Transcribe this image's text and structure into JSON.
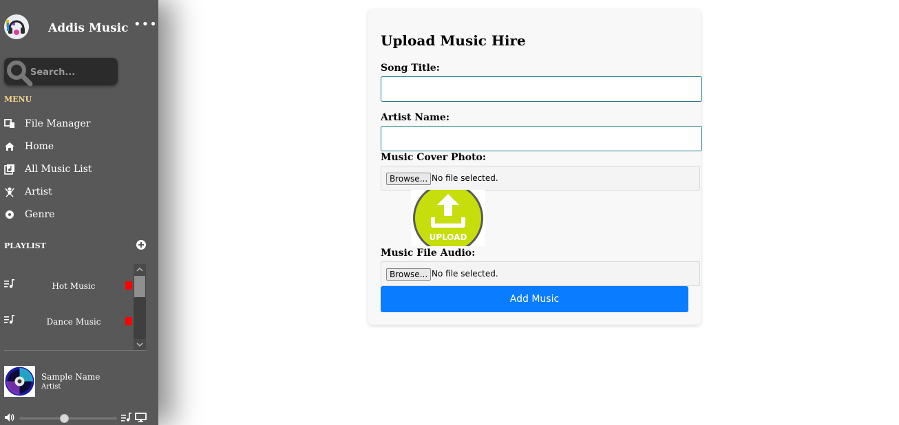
{
  "app": {
    "name": "Addis Music",
    "more_icon": "more-dots-icon"
  },
  "search": {
    "placeholder": "Search...",
    "icon": "search-icon"
  },
  "menu": {
    "heading": "MENU",
    "items": [
      {
        "label": "File Manager",
        "icon": "file-manager-icon"
      },
      {
        "label": "Home",
        "icon": "home-icon"
      },
      {
        "label": "All Music List",
        "icon": "music-list-icon"
      },
      {
        "label": "Artist",
        "icon": "artist-icon"
      },
      {
        "label": "Genre",
        "icon": "genre-disc-icon"
      }
    ]
  },
  "playlist": {
    "heading": "PLAYLIST",
    "add_icon": "add-circle-icon",
    "items": [
      {
        "label": "Hot Music",
        "icon": "playlist-icon",
        "delete_color": "#ff0000"
      },
      {
        "label": "Dance Music",
        "icon": "playlist-icon",
        "delete_color": "#ff0000"
      }
    ]
  },
  "now_playing": {
    "title": "Sample Name",
    "artist": "Artist",
    "art_icon": "cd-disc-icon",
    "volume_fraction": 0.46
  },
  "form": {
    "title": "Upload Music Hire",
    "song_title_label": "Song Title:",
    "song_title_value": "",
    "artist_name_label": "Artist Name:",
    "artist_name_value": "",
    "cover_label": "Music Cover Photo:",
    "cover_browse": "Browse...",
    "cover_status": "No file selected.",
    "upload_image_text": "UPLOAD",
    "audio_label": "Music File Audio:",
    "audio_browse": "Browse...",
    "audio_status": "No file selected.",
    "submit_label": "Add Music"
  },
  "colors": {
    "sidebar_bg": "#585858",
    "menu_heading": "#f4d58a",
    "submit_bg": "#0a7cff",
    "upload_green": "#c5de0c"
  }
}
